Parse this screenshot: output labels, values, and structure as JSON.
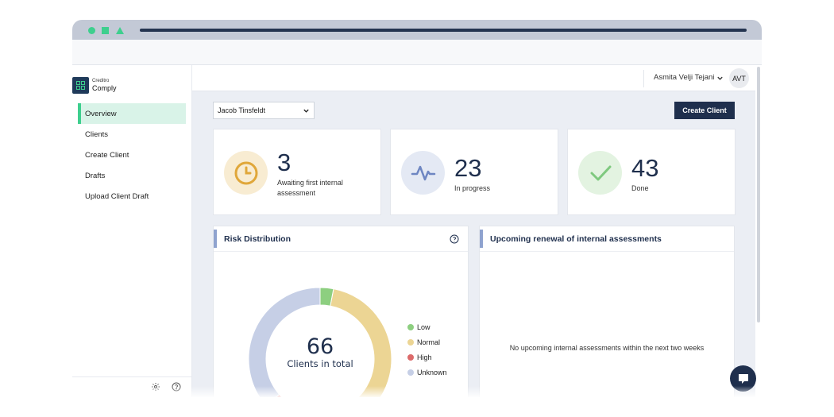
{
  "app": {
    "brand_small": "Creditro",
    "brand_name": "Comply"
  },
  "sidebar": {
    "items": [
      {
        "label": "Overview",
        "active": true
      },
      {
        "label": "Clients"
      },
      {
        "label": "Create Client"
      },
      {
        "label": "Drafts"
      },
      {
        "label": "Upload Client Draft"
      }
    ],
    "footer_icons": [
      "settings-icon",
      "help-icon"
    ]
  },
  "topbar": {
    "user_name": "Asmita Velji Tejani",
    "avatar_initials": "AVT"
  },
  "toolbar": {
    "client_select_value": "Jacob Tinsfeldt",
    "create_client_label": "Create Client"
  },
  "stats": [
    {
      "value": "3",
      "label": "Awaiting first internal assessment",
      "icon": "clock-icon",
      "color": "#e0a73a",
      "bg": "#f8ecd2"
    },
    {
      "value": "23",
      "label": "In progress",
      "icon": "activity-icon",
      "color": "#6e86c2",
      "bg": "#e4e9f4"
    },
    {
      "value": "43",
      "label": "Done",
      "icon": "check-icon",
      "color": "#7fc97f",
      "bg": "#e3f3e1"
    }
  ],
  "risk_panel": {
    "title": "Risk Distribution",
    "total_value": "66",
    "total_label": "Clients in total"
  },
  "renewal_panel": {
    "title": "Upcoming renewal of internal assessments",
    "empty_message": "No upcoming internal assessments within the next two weeks"
  },
  "chart_data": {
    "type": "pie",
    "title": "Risk Distribution",
    "categories": [
      "Low",
      "Normal",
      "High",
      "Unknown"
    ],
    "values": [
      2,
      34,
      6,
      24
    ],
    "colors": [
      "#8dcf80",
      "#ecd594",
      "#dc6a6a",
      "#c6cfe6"
    ],
    "legend_position": "right"
  },
  "colors": {
    "accent": "#3ecf8e",
    "primary_dark": "#1f2f4d",
    "page_bg": "#ebeef4"
  }
}
